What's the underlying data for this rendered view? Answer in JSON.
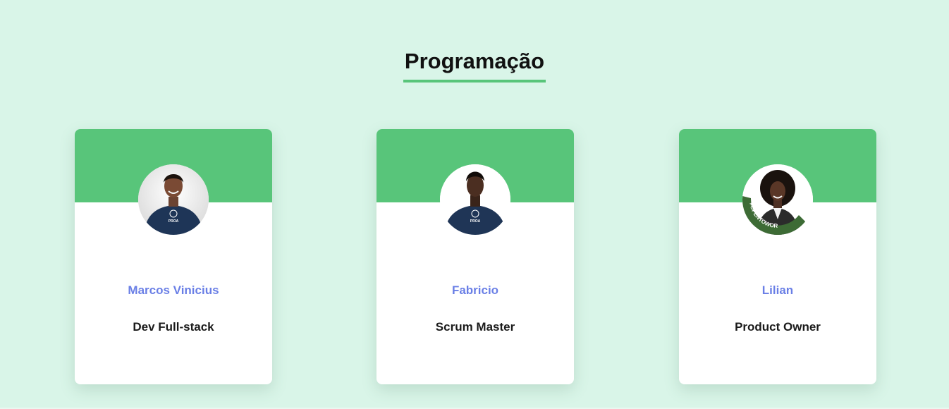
{
  "section": {
    "title": "Programação"
  },
  "colors": {
    "background": "#d9f5e8",
    "accent": "#58c57a",
    "name": "#6a7fe6",
    "role": "#1a1a1a"
  },
  "team": [
    {
      "name": "Marcos Vinicius",
      "role": "Dev Full-stack",
      "shirt_logo": "PROA"
    },
    {
      "name": "Fabricio",
      "role": "Scrum Master",
      "shirt_logo": "PROA"
    },
    {
      "name": "Lilian",
      "role": "Product Owner",
      "frame_text": "#OPENTOWORK"
    }
  ]
}
